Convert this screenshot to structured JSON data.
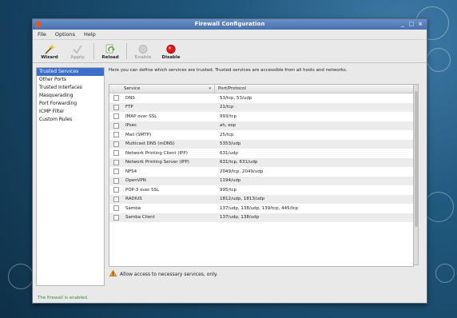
{
  "window": {
    "title": "Firewall Configuration",
    "controls": [
      "_",
      "□",
      "×"
    ]
  },
  "menu": [
    "File",
    "Options",
    "Help"
  ],
  "toolbar": {
    "buttons": [
      {
        "label": "Wizard",
        "icon": "wizard-wand-icon",
        "enabled": true
      },
      {
        "label": "Apply",
        "icon": "apply-check-icon",
        "enabled": false
      },
      {
        "label": "Reload",
        "icon": "reload-icon",
        "enabled": true
      },
      {
        "label": "Enable",
        "icon": "enable-circle-icon",
        "enabled": false
      },
      {
        "label": "Disable",
        "icon": "disable-red-dot-icon",
        "enabled": true
      }
    ]
  },
  "sidebar": {
    "items": [
      {
        "label": "Trusted Services",
        "selected": true
      },
      {
        "label": "Other Ports"
      },
      {
        "label": "Trusted Interfaces"
      },
      {
        "label": "Masquerading"
      },
      {
        "label": "Port Forwarding"
      },
      {
        "label": "ICMP Filter"
      },
      {
        "label": "Custom Rules"
      }
    ]
  },
  "main": {
    "description": "Here you can define which services are trusted. Trusted services are accessible from all hosts and networks.",
    "columns": {
      "service": "Service",
      "port": "Port/Protocol"
    },
    "rows": [
      {
        "service": "DNS",
        "port": "53/tcp, 53/udp"
      },
      {
        "service": "FTP",
        "port": "21/tcp"
      },
      {
        "service": "IMAP over SSL",
        "port": "993/tcp"
      },
      {
        "service": "IPsec",
        "port": "ah, esp"
      },
      {
        "service": "Mail (SMTP)",
        "port": "25/tcp"
      },
      {
        "service": "Multicast DNS (mDNS)",
        "port": "5353/udp"
      },
      {
        "service": "Network Printing Client (IPP)",
        "port": "631/udp"
      },
      {
        "service": "Network Printing Server (IPP)",
        "port": "631/tcp, 631/udp"
      },
      {
        "service": "NFS4",
        "port": "2049/tcp, 2049/udp"
      },
      {
        "service": "OpenVPN",
        "port": "1194/udp"
      },
      {
        "service": "POP-3 over SSL",
        "port": "995/tcp"
      },
      {
        "service": "RADIUS",
        "port": "1812/udp, 1813/udp"
      },
      {
        "service": "Samba",
        "port": "137/udp, 138/udp, 139/tcp, 445/tcp"
      },
      {
        "service": "Samba Client",
        "port": "137/udp, 138/udp"
      }
    ],
    "warning": "Allow access to necessary services, only."
  },
  "status": "The firewall is enabled.",
  "colors": {
    "title_bar": "#4871b0",
    "selection": "#3d6ec9",
    "status_text": "#3a8a3a",
    "desktop": "#20597f"
  }
}
